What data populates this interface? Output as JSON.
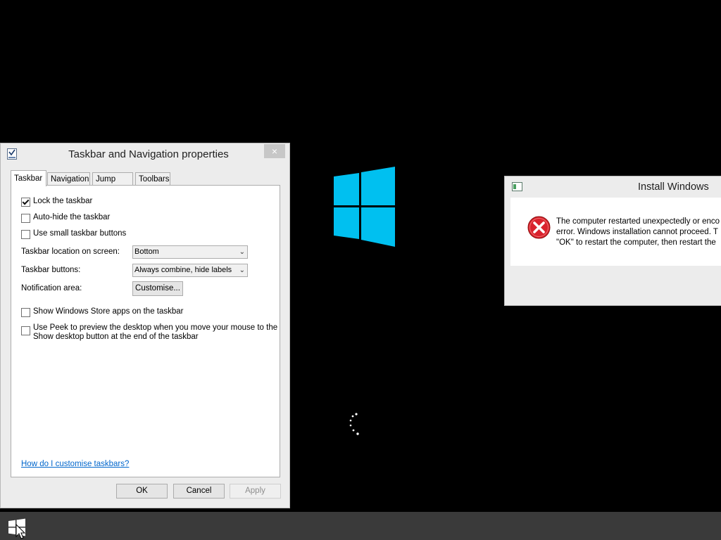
{
  "taskbar_dialog": {
    "title": "Taskbar and Navigation properties",
    "close_label": "×",
    "tabs": [
      {
        "label": "Taskbar",
        "active": true
      },
      {
        "label": "Navigation",
        "active": false
      },
      {
        "label": "Jump Lists",
        "active": false
      },
      {
        "label": "Toolbars",
        "active": false
      }
    ],
    "options": {
      "lock_taskbar": {
        "label": "Lock the taskbar",
        "checked": true
      },
      "auto_hide": {
        "label": "Auto-hide the taskbar",
        "checked": false
      },
      "small_buttons": {
        "label": "Use small taskbar buttons",
        "checked": false
      },
      "store_apps": {
        "label": "Show Windows Store apps on the taskbar",
        "checked": false
      },
      "peek": {
        "label_line1": "Use Peek to preview the desktop when you move your mouse to the",
        "label_line2": "Show desktop button at the end of the taskbar",
        "checked": false
      }
    },
    "location": {
      "label": "Taskbar location on screen:",
      "value": "Bottom"
    },
    "buttons": {
      "label": "Taskbar buttons:",
      "value": "Always combine, hide labels"
    },
    "notification": {
      "label": "Notification area:",
      "button": "Customise..."
    },
    "help_link": "How do I customise taskbars?",
    "ok": "OK",
    "cancel": "Cancel",
    "apply": "Apply"
  },
  "install_dialog": {
    "title": "Install Windows",
    "message_lines": [
      "The computer restarted unexpectedly or enco",
      "error. Windows installation cannot proceed. T",
      "\"OK\" to restart the computer, then restart the"
    ]
  },
  "colors": {
    "desktop": "#000000",
    "logo": "#00c0f0",
    "taskbar": "#3a3a3a",
    "link": "#0066cc",
    "error_red": "#d9232e"
  },
  "icons": {
    "start": "windows-start-icon",
    "error": "error-x-icon",
    "spinner": "loading-dots-icon"
  }
}
